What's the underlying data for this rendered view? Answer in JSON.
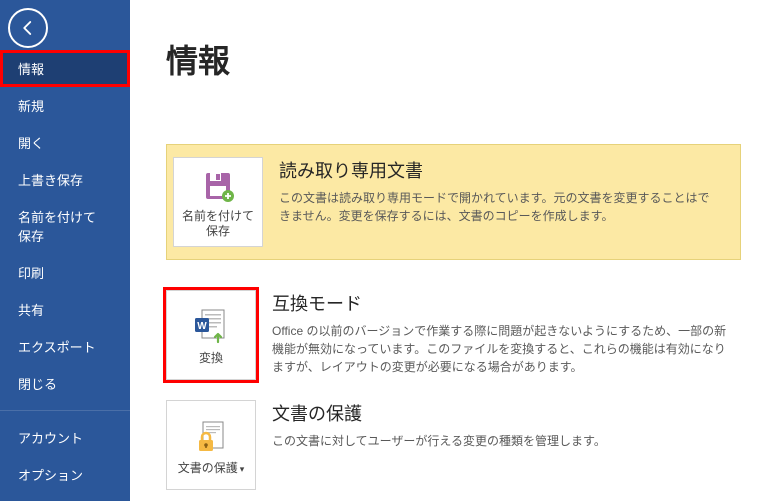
{
  "sidebar": {
    "items": [
      {
        "label": "情報"
      },
      {
        "label": "新規"
      },
      {
        "label": "開く"
      },
      {
        "label": "上書き保存"
      },
      {
        "label": "名前を付けて\n保存"
      },
      {
        "label": "印刷"
      },
      {
        "label": "共有"
      },
      {
        "label": "エクスポート"
      },
      {
        "label": "閉じる"
      },
      {
        "label": "アカウント"
      },
      {
        "label": "オプション"
      }
    ]
  },
  "page_title": "情報",
  "readonly": {
    "button_label": "名前を付けて保存",
    "title": "読み取り専用文書",
    "desc": "この文書は読み取り専用モードで開かれています。元の文書を変更することはできません。変更を保存するには、文書のコピーを作成します。"
  },
  "compat": {
    "button_label": "変換",
    "title": "互換モード",
    "desc": "Office の以前のバージョンで作業する際に問題が起きないようにするため、一部の新機能が無効になっています。このファイルを変換すると、これらの機能は有効になりますが、レイアウトの変更が必要になる場合があります。"
  },
  "protect": {
    "button_label": "文書の保護",
    "title": "文書の保護",
    "desc": "この文書に対してユーザーが行える変更の種類を管理します。"
  }
}
